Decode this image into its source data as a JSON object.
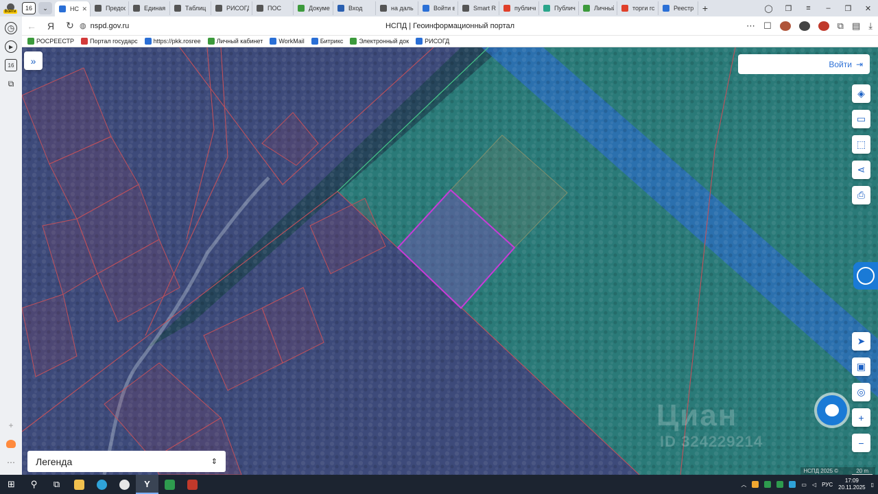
{
  "browser": {
    "profile_label": "Войти",
    "tab_count": "16",
    "tabs": [
      {
        "label": "НСПД",
        "color": "#2a6fd6",
        "active": true
      },
      {
        "label": "Предос",
        "color": "#555555"
      },
      {
        "label": "Единая",
        "color": "#555555"
      },
      {
        "label": "Таблиц",
        "color": "#555555"
      },
      {
        "label": "РИСОГД",
        "color": "#555555"
      },
      {
        "label": "ПОС",
        "color": "#555555"
      },
      {
        "label": "Докуме",
        "color": "#3c9a3c"
      },
      {
        "label": "Вход",
        "color": "#2a5fb0"
      },
      {
        "label": "на даль",
        "color": "#555555"
      },
      {
        "label": "Войти в",
        "color": "#2a6fd6"
      },
      {
        "label": "Smart R",
        "color": "#555555"
      },
      {
        "label": "публичн",
        "color": "#e0402a"
      },
      {
        "label": "Публич",
        "color": "#2aa58a"
      },
      {
        "label": "Личный",
        "color": "#3c9a3c"
      },
      {
        "label": "торги гс",
        "color": "#e0402a"
      },
      {
        "label": "Реестр",
        "color": "#2a6fd6"
      }
    ],
    "url": "nspd.gov.ru",
    "page_title": "НСПД | Геоинформационный портал",
    "bookmarks": [
      {
        "label": "РОСРЕЕСТР",
        "color": "#3c9a3c"
      },
      {
        "label": "Портал государс",
        "color": "#d33a3a"
      },
      {
        "label": "https://pkk.rosree",
        "color": "#2a6fd6"
      },
      {
        "label": "Личный кабинет",
        "color": "#3c9a3c"
      },
      {
        "label": "WorkMail",
        "color": "#2a6fd6"
      },
      {
        "label": "Битрикс",
        "color": "#2a6fd6"
      },
      {
        "label": "Электронный док",
        "color": "#3c9a3c"
      },
      {
        "label": "РИСОГД",
        "color": "#2a6fd6"
      }
    ],
    "rail_badge": "16"
  },
  "map": {
    "login_label": "Войти",
    "watermark_main": "Циан",
    "watermark_id": "ID 324229214",
    "legend_label": "Легенда",
    "copyright": "НСПД 2025 ©",
    "scale_label": "20 m"
  },
  "taskbar": {
    "lang": "РУС",
    "time": "17:09",
    "date": "20.11.2025"
  }
}
